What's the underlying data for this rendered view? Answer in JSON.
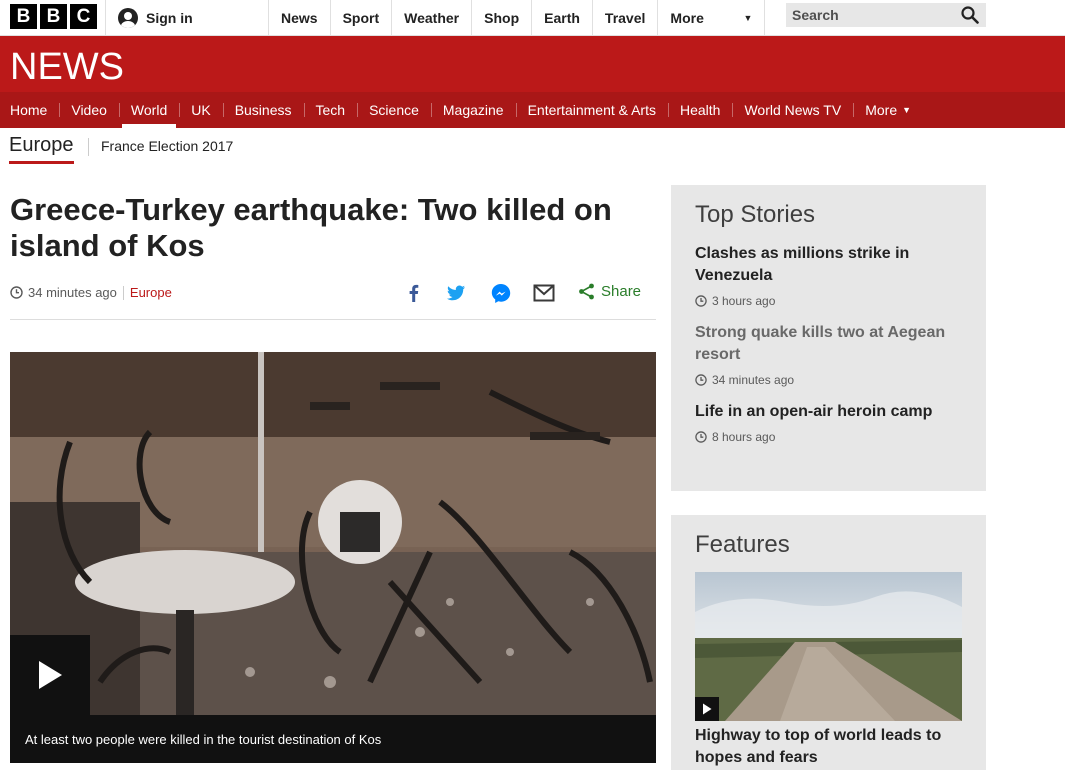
{
  "global": {
    "logo_letters": [
      "B",
      "B",
      "C"
    ],
    "signin_label": "Sign in",
    "nav": [
      "News",
      "Sport",
      "Weather",
      "Shop",
      "Earth",
      "Travel"
    ],
    "more_label": "More",
    "search_placeholder": "Search"
  },
  "news": {
    "wordmark": "NEWS",
    "nav": [
      "Home",
      "Video",
      "World",
      "UK",
      "Business",
      "Tech",
      "Science",
      "Magazine",
      "Entertainment & Arts",
      "Health",
      "World News TV"
    ],
    "active_item": "World",
    "more_label": "More"
  },
  "subnav": {
    "section": "Europe",
    "items": [
      "France Election 2017"
    ]
  },
  "article": {
    "headline": "Greece-Turkey earthquake: Two killed on island of Kos",
    "timestamp": "34 minutes ago",
    "section_link": "Europe",
    "share_label": "Share",
    "share_icons": [
      "facebook-icon",
      "twitter-icon",
      "messenger-icon",
      "email-icon"
    ],
    "media_caption": "At least two people were killed in the tourist destination of Kos"
  },
  "sidebar": {
    "top_stories": {
      "heading": "Top Stories",
      "items": [
        {
          "title": "Clashes as millions strike in Venezuela",
          "time": "3 hours ago"
        },
        {
          "title": "Strong quake kills two at Aegean resort",
          "time": "34 minutes ago"
        },
        {
          "title": "Life in an open-air heroin camp",
          "time": "8 hours ago"
        }
      ]
    },
    "features": {
      "heading": "Features",
      "items": [
        {
          "title": "Highway to top of world leads to hopes and fears"
        }
      ]
    }
  },
  "colors": {
    "brand_red": "#bb1919",
    "nav_red": "#a91717",
    "panel_grey": "#e7e7e7",
    "share_green": "#2a7d2a"
  }
}
